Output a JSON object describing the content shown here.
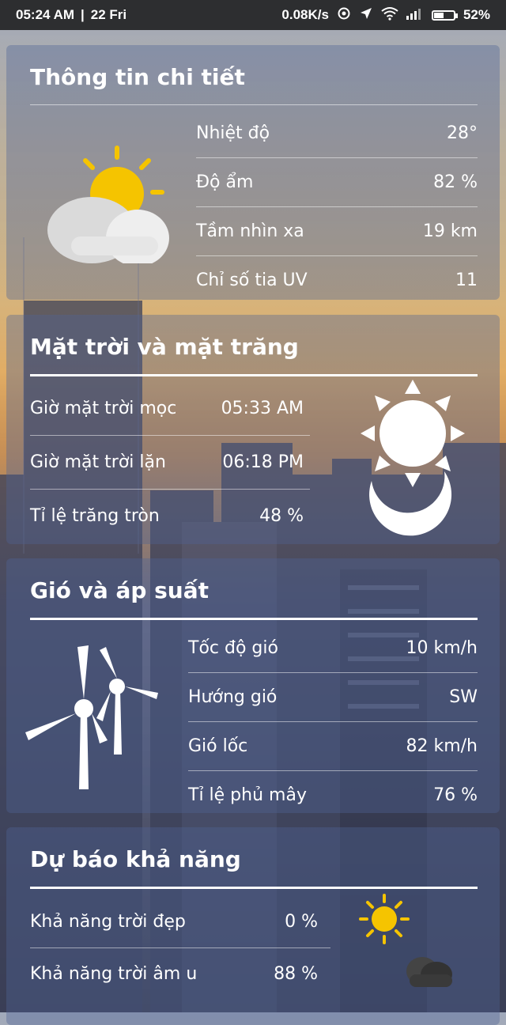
{
  "status_bar": {
    "time": "05:24 AM",
    "separator": "|",
    "date": "22 Fri",
    "net_speed": "0.08K/s",
    "battery": "52%",
    "battery_level": 0.52
  },
  "details": {
    "title": "Thông tin chi tiết",
    "icon": "partly-cloudy-icon",
    "rows": [
      {
        "label": "Nhiệt độ",
        "value": "28°"
      },
      {
        "label": "Độ ẩm",
        "value": "82 %"
      },
      {
        "label": "Tầm nhìn xa",
        "value": "19 km"
      },
      {
        "label": "Chỉ số tia UV",
        "value": "11"
      }
    ]
  },
  "sun_moon": {
    "title": "Mặt trời và mặt trăng",
    "icon": "sun-moon-icon",
    "rows": [
      {
        "label": "Giờ mặt trời mọc",
        "value": "05:33 AM"
      },
      {
        "label": "Giờ mặt trời lặn",
        "value": "06:18 PM"
      },
      {
        "label": "Tỉ lệ trăng tròn",
        "value": "48 %"
      }
    ]
  },
  "wind": {
    "title": "Gió và áp suất",
    "icon": "wind-turbine-icon",
    "rows": [
      {
        "label": "Tốc độ gió",
        "value": "10 km/h"
      },
      {
        "label": "Hướng gió",
        "value": "SW"
      },
      {
        "label": "Gió lốc",
        "value": "82 km/h"
      },
      {
        "label": "Tỉ lệ phủ mây",
        "value": "76 %"
      }
    ]
  },
  "forecast": {
    "title": "Dự báo khả năng",
    "rows": [
      {
        "label": "Khả năng trời đẹp",
        "value": "0 %",
        "icon": "sun-icon"
      },
      {
        "label": "Khả năng trời âm u",
        "value": "88 %",
        "icon": "dark-cloud-icon"
      }
    ]
  },
  "colors": {
    "status_bar_bg": "#2d2e30",
    "card_bg": "rgba(80,100,150,0.38)",
    "sun_yellow": "#f5c400",
    "text": "#ffffff"
  }
}
